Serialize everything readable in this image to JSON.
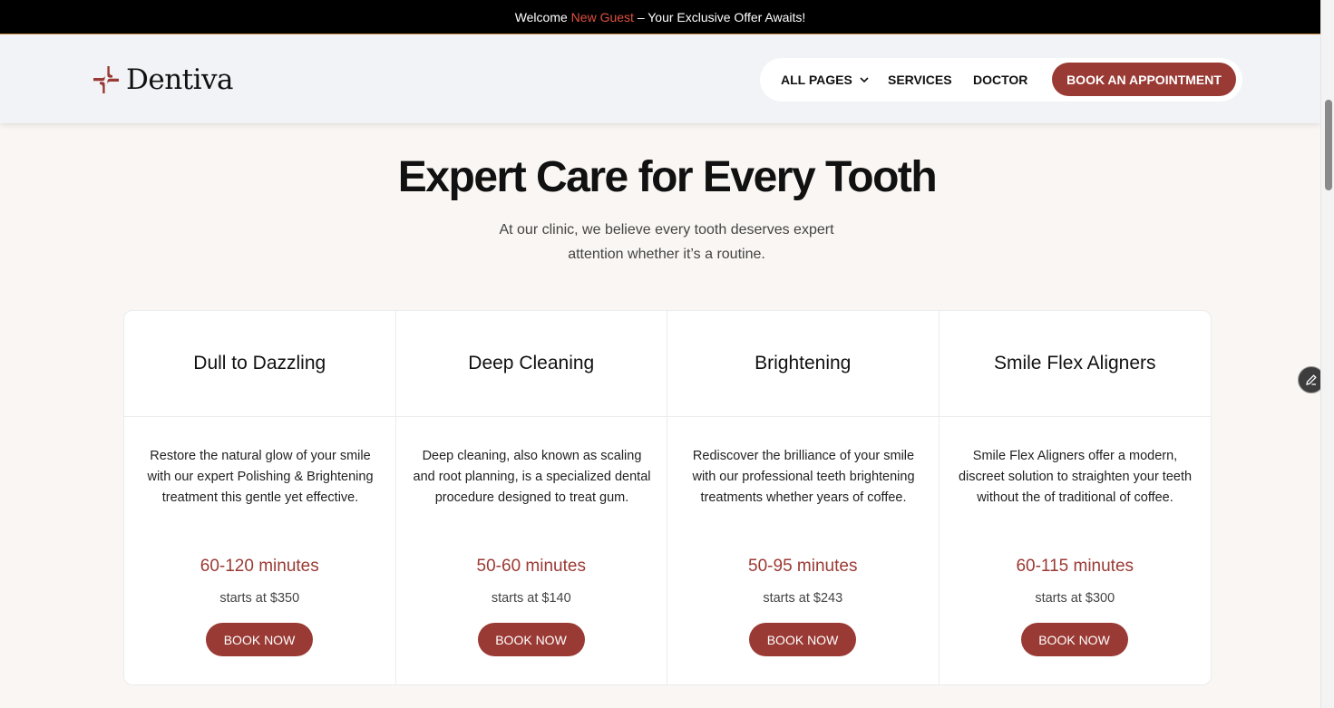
{
  "announcement": {
    "prefix": "Welcome",
    "highlight": "New Guest",
    "suffix": "– Your Exclusive Offer Awaits!"
  },
  "header": {
    "logo_text": "Dentiva",
    "nav": {
      "all_pages": "ALL PAGES",
      "services": "SERVICES",
      "doctor": "DOCTOR",
      "cta": "BOOK AN APPOINTMENT"
    }
  },
  "section": {
    "title": "Expert Care for Every Tooth",
    "subtitle": "At our clinic, we believe every tooth deserves expert attention whether it’s a routine."
  },
  "services": [
    {
      "title": "Dull to Dazzling",
      "description": "Restore the natural glow of your smile with our expert Polishing & Brightening treatment this gentle yet effective.",
      "duration": "60-120 minutes",
      "price": "starts at $350",
      "button": "BOOK NOW"
    },
    {
      "title": "Deep Cleaning",
      "description": "Deep cleaning, also known as scaling and root planning, is a specialized dental procedure designed to treat gum.",
      "duration": "50-60 minutes",
      "price": "starts at $140",
      "button": "BOOK NOW"
    },
    {
      "title": "Brightening",
      "description": "Rediscover the brilliance of your smile with our professional teeth brightening treatments whether years of coffee.",
      "duration": "50-95 minutes",
      "price": "starts at $243",
      "button": "BOOK NOW"
    },
    {
      "title": "Smile Flex Aligners",
      "description": "Smile Flex Aligners offer a modern, discreet solution to straighten your teeth without the of traditional of coffee.",
      "duration": "60-115 minutes",
      "price": "starts at $300",
      "button": "BOOK NOW"
    }
  ],
  "icons": {
    "logo": "cross-logo-icon",
    "dropdown": "chevron-down-icon",
    "edit": "pencil-icon"
  },
  "colors": {
    "brand": "#9a3a34",
    "highlight": "#e0503f",
    "topbar": "#000000",
    "page_bg": "#f9f6f3"
  }
}
